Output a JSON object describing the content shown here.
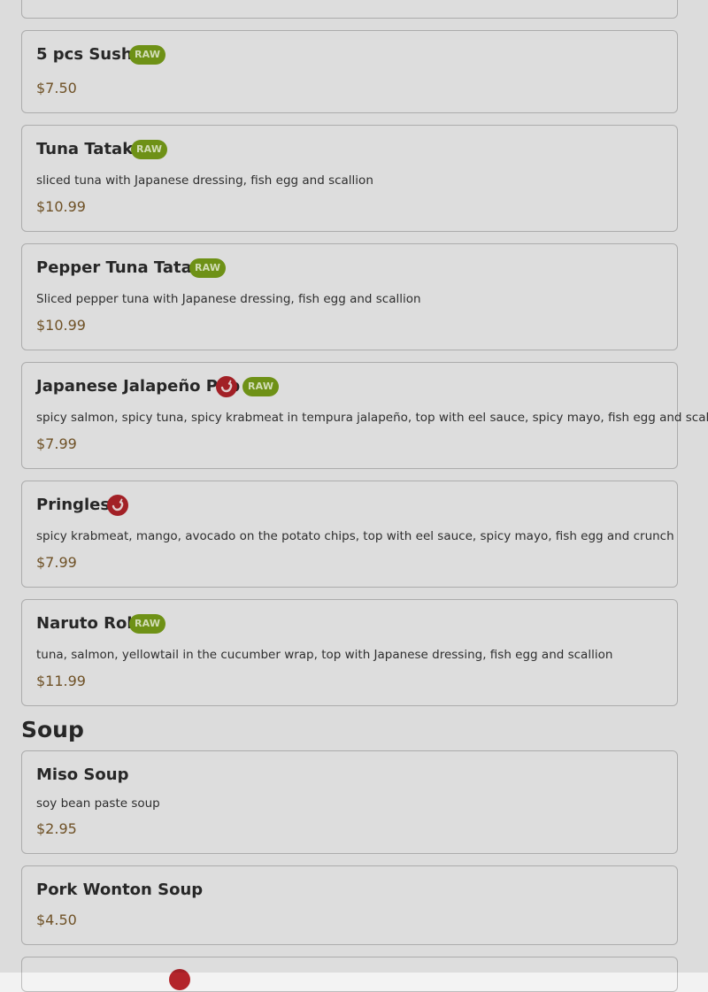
{
  "raw_badge_label": "RAW",
  "colors": {
    "raw_badge": "#79a019",
    "spicy_icon": "#b3242a",
    "price": "#7a5a2a"
  },
  "items": [
    {
      "name": "5 pcs Sushi",
      "price": "$7.50",
      "tags": [
        "raw"
      ]
    },
    {
      "name": "Tuna Tataki",
      "description": "sliced tuna with Japanese dressing, fish egg and scallion",
      "price": "$10.99",
      "tags": [
        "raw"
      ]
    },
    {
      "name": "Pepper Tuna Tataki",
      "description": "Sliced pepper tuna with Japanese dressing, fish egg and scallion",
      "price": "$10.99",
      "tags": [
        "raw"
      ]
    },
    {
      "name": "Japanese Jalapeño Pop",
      "description": "spicy salmon, spicy tuna, spicy krabmeat in tempura jalapeño, top with eel sauce, spicy mayo, fish egg and scallion",
      "price": "$7.99",
      "tags": [
        "spicy",
        "raw"
      ]
    },
    {
      "name": "Pringles",
      "description": "spicy krabmeat, mango, avocado on the potato chips, top with eel sauce, spicy mayo, fish egg and crunch",
      "price": "$7.99",
      "tags": [
        "spicy"
      ]
    },
    {
      "name": "Naruto Roll",
      "description": "tuna, salmon, yellowtail in the cucumber wrap, top with Japanese dressing, fish egg and scallion",
      "price": "$11.99",
      "tags": [
        "raw"
      ]
    }
  ],
  "soup_section": {
    "title": "Soup",
    "items": [
      {
        "name": "Miso Soup",
        "description": "soy bean paste soup",
        "price": "$2.95",
        "tags": []
      },
      {
        "name": "Pork Wonton Soup",
        "price": "$4.50",
        "tags": []
      }
    ]
  }
}
